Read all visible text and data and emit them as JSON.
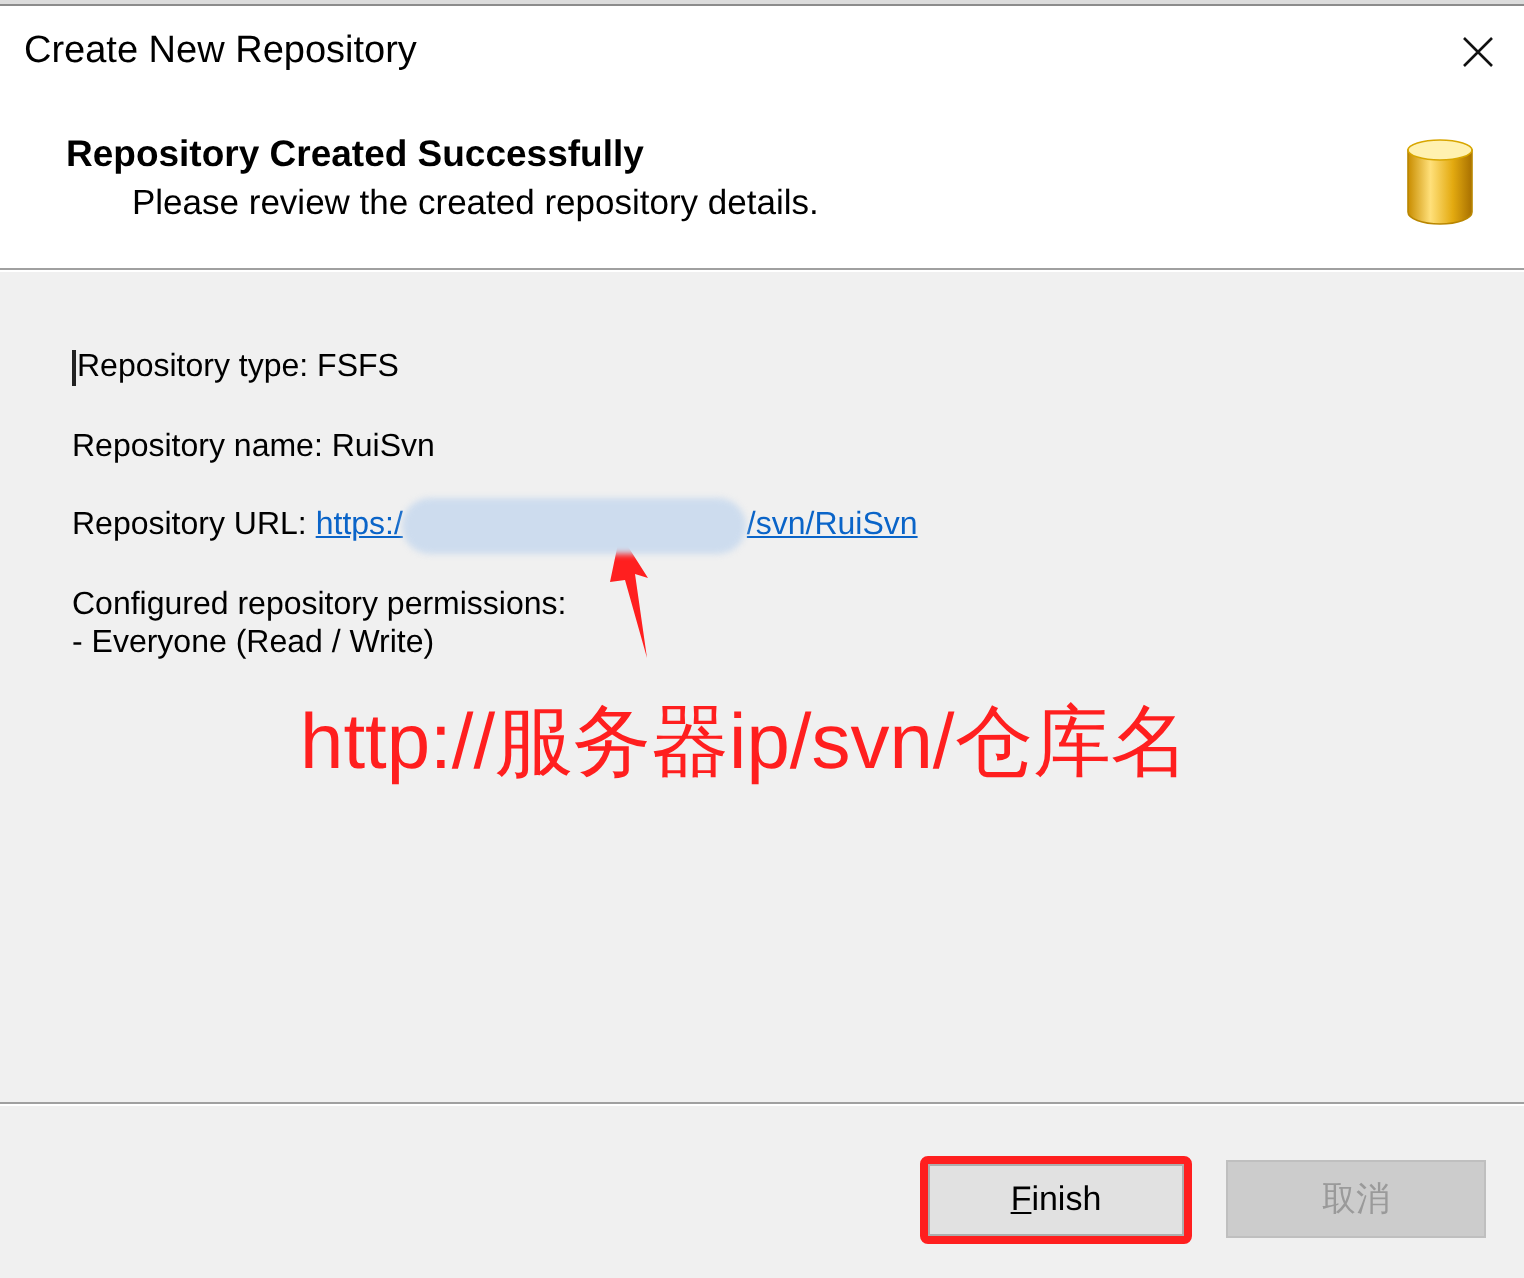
{
  "window": {
    "title": "Create New Repository"
  },
  "header": {
    "title": "Repository Created Successfully",
    "subtitle": "Please review the created repository details."
  },
  "details": [
    {
      "kind": "text",
      "text": "Repository type: FSFS",
      "caret": true
    },
    {
      "kind": "text",
      "text": "Repository name: RuiSvn",
      "caret": false
    },
    {
      "kind": "link",
      "label": "Repository URL:",
      "url_start": "https:/",
      "url_end": "/svn/RuiSvn",
      "caret": false
    },
    {
      "kind": "multiline",
      "text": "Configured repository permissions:\n- Everyone (Read / Write)",
      "caret": false
    }
  ],
  "annotation": {
    "text": "http://服务器ip/svn/仓库名"
  },
  "buttons": [
    {
      "label": "Finish",
      "disabled": false,
      "highlighted": true,
      "mnemonic": true
    },
    {
      "label": "取消",
      "disabled": true,
      "highlighted": false,
      "mnemonic": false
    }
  ]
}
